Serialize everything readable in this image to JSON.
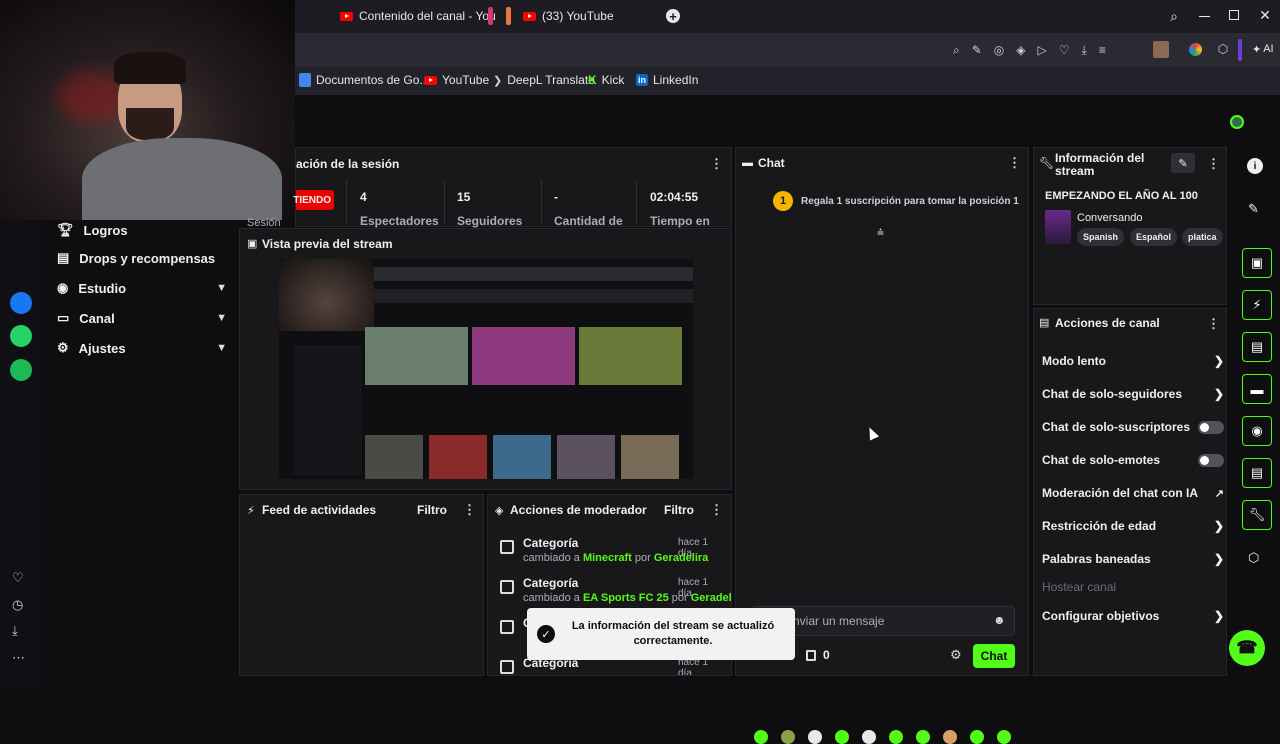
{
  "browser": {
    "tabs": [
      {
        "label": "Contenido del canal - You"
      },
      {
        "label": "(33) YouTube"
      }
    ],
    "bookmarks": [
      {
        "label": "Documentos de Go..."
      },
      {
        "label": "YouTube"
      },
      {
        "label": "DeepL Translate"
      },
      {
        "label": "Kick"
      },
      {
        "label": "LinkedIn"
      }
    ],
    "toolbar_ai_label": "AI"
  },
  "left_nav": {
    "items": [
      {
        "label": "Logros"
      },
      {
        "label": "Drops y recompensas"
      },
      {
        "label": "Estudio"
      },
      {
        "label": "Canal"
      },
      {
        "label": "Ajustes"
      }
    ]
  },
  "session": {
    "title": "ación de la sesión",
    "status": "TIENDO",
    "stats": [
      {
        "value": "4",
        "label": "Espectadores"
      },
      {
        "value": "15",
        "label": "Seguidores"
      },
      {
        "value": "-",
        "label": "Cantidad de"
      },
      {
        "value": "02:04:55",
        "label": "Tiempo en"
      }
    ],
    "cut_label": "Sesión"
  },
  "preview": {
    "title": "Vista previa del stream"
  },
  "feed": {
    "title": "Feed de actividades",
    "filter": "Filtro"
  },
  "mod_actions": {
    "title": "Acciones de moderador",
    "filter": "Filtro",
    "rows": [
      {
        "title": "Categoría",
        "time": "hace 1 día",
        "prefix": "cambiado a",
        "category": "Minecraft",
        "by": "por",
        "user": "Geradelira"
      },
      {
        "title": "Categoría",
        "time": "hace 1 día",
        "prefix": "cambiado a",
        "category": "EA Sports FC 25",
        "by": "por",
        "user": "Geradelira"
      },
      {
        "title": "C",
        "time": "",
        "prefix": "",
        "category": "",
        "by": "",
        "user": ""
      },
      {
        "title": "Categoría",
        "time": "hace 1 día",
        "prefix": "",
        "category": "",
        "by": "",
        "user": ""
      }
    ]
  },
  "chat": {
    "title": "Chat",
    "gift_badge": "1",
    "gift_text": "Regala 1 suscripción para tomar la posición 1",
    "input_placeholder": "nviar un mensaje",
    "count": "0",
    "send_label": "Chat"
  },
  "toast": {
    "text": "La información del stream se actualizó correctamente."
  },
  "stream_info": {
    "title": "Información del stream",
    "stream_title": "EMPEZANDO EL AÑO AL 100",
    "category": "Conversando",
    "tags": [
      "Spanish",
      "Español",
      "platica"
    ]
  },
  "channel_actions": {
    "title": "Acciones de canal",
    "items": [
      {
        "label": "Modo lento",
        "control": "chevron"
      },
      {
        "label": "Chat de solo-seguidores",
        "control": "chevron"
      },
      {
        "label": "Chat de solo-suscriptores",
        "control": "toggle"
      },
      {
        "label": "Chat de solo-emotes",
        "control": "toggle"
      },
      {
        "label": "Moderación del chat con IA",
        "control": "external"
      },
      {
        "label": "Restricción de edad",
        "control": "chevron"
      },
      {
        "label": "Palabras baneadas",
        "control": "chevron"
      },
      {
        "label": "Hostear canal",
        "control": "none"
      },
      {
        "label": "Configurar objetivos",
        "control": "chevron"
      }
    ]
  },
  "colors": {
    "accent": "#53fc18",
    "live": "#eb0400",
    "panel": "#18181b",
    "background": "#0e0e10"
  }
}
